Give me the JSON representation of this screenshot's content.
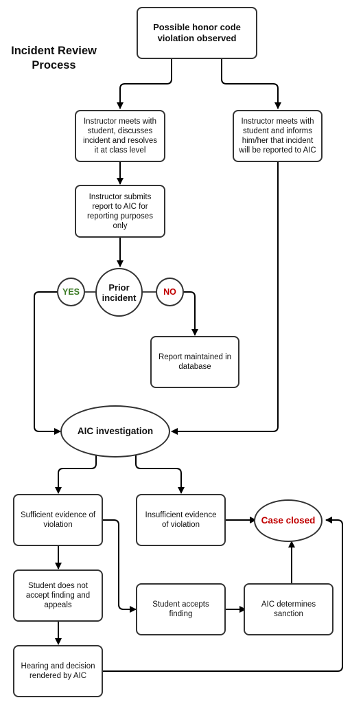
{
  "title": "Incident Review Process",
  "colors": {
    "yes": "#3a7a23",
    "no": "#c00000",
    "case_closed": "#c00000",
    "stroke": "#333333"
  },
  "nodes": {
    "start": "Possible honor code violation observed",
    "resolve_class": "Instructor meets with student, discusses incident and resolves it at class level",
    "inform_student": "Instructor meets with student and informs him/her that incident will be reported to AIC",
    "submit_report": "Instructor submits report to AIC for reporting purposes only",
    "prior_incident": "Prior incident",
    "yes": "YES",
    "no": "NO",
    "report_maintained": "Report maintained in database",
    "aic_investigation": "AIC investigation",
    "sufficient": "Sufficient evidence of violation",
    "insufficient": "Insufficient evidence of violation",
    "case_closed": "Case closed",
    "not_accept": "Student does not accept finding and appeals",
    "accepts": "Student accepts finding",
    "determines_sanction": "AIC determines sanction",
    "hearing": "Hearing and decision rendered by AIC"
  }
}
